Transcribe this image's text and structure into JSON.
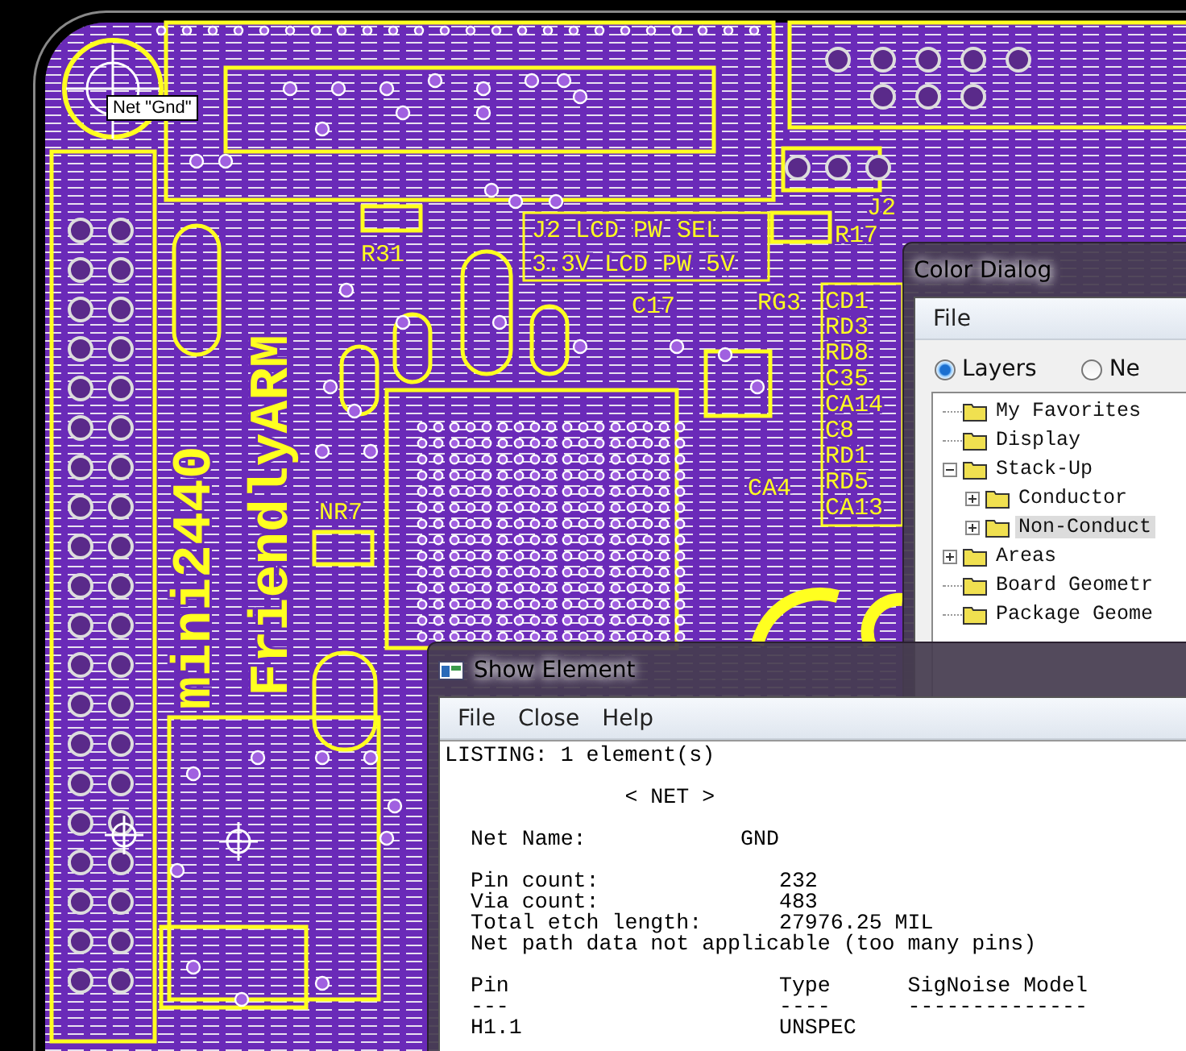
{
  "board": {
    "tooltip": "Net \"Gnd\"",
    "silkscreen": [
      {
        "text": "mini2440",
        "kind": "title"
      },
      {
        "text": "FriendlyARM",
        "kind": "title"
      },
      {
        "text": "J2 LCD PW SEL",
        "kind": "label"
      },
      {
        "text": "3.3V LCD PW 5V",
        "kind": "label"
      },
      {
        "text": "R31",
        "kind": "label"
      },
      {
        "text": "C17",
        "kind": "label"
      },
      {
        "text": "RG3",
        "kind": "label"
      },
      {
        "text": "J2",
        "kind": "label"
      },
      {
        "text": "R17",
        "kind": "label"
      },
      {
        "text": "NR7",
        "kind": "label"
      },
      {
        "text": "CD1",
        "kind": "label"
      },
      {
        "text": "RD3",
        "kind": "label"
      },
      {
        "text": "RD8",
        "kind": "label"
      },
      {
        "text": "C35",
        "kind": "label"
      },
      {
        "text": "CA14",
        "kind": "label"
      },
      {
        "text": "C8",
        "kind": "label"
      },
      {
        "text": "RD1",
        "kind": "label"
      },
      {
        "text": "RD5",
        "kind": "label"
      },
      {
        "text": "CA13",
        "kind": "label"
      },
      {
        "text": "CA4",
        "kind": "label"
      }
    ]
  },
  "color_dialog": {
    "title": "Color Dialog",
    "menu": [
      "File"
    ],
    "radios": [
      {
        "label": "Layers",
        "selected": true
      },
      {
        "label": "Ne",
        "selected": false
      }
    ],
    "tree": [
      {
        "label": "My Favorites",
        "selected": false
      },
      {
        "label": "Display",
        "selected": false
      },
      {
        "label": "Stack-Up",
        "selected": false,
        "expanded": true,
        "children": [
          {
            "label": "Conductor",
            "selected": false,
            "expanded": false
          },
          {
            "label": "Non-Conduct",
            "selected": true,
            "expanded": false
          }
        ]
      },
      {
        "label": "Areas",
        "selected": false,
        "expanded": false
      },
      {
        "label": "Board Geometr",
        "selected": false
      },
      {
        "label": "Package Geome",
        "selected": false
      }
    ]
  },
  "show_element": {
    "title": "Show Element",
    "menu": [
      "File",
      "Close",
      "Help"
    ],
    "listing": [
      [
        "LISTING: 1 element(s)"
      ],
      [
        "              < NET >"
      ],
      [
        "  Net Name:            GND"
      ],
      [
        "  Pin count:              232",
        "  Via count:              483",
        "  Total etch length:      27976.25 MIL",
        "  Net path data not applicable (too many pins)"
      ],
      [
        "  Pin                     Type      SigNoise Model",
        "  ---                     ----      --------------",
        "  H1.1                    UNSPEC"
      ]
    ]
  }
}
